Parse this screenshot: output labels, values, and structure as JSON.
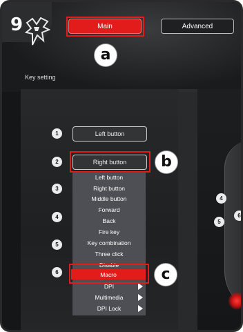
{
  "step_number": "9",
  "tabs": {
    "main_label": "Main",
    "advanced_label": "Advanced"
  },
  "section_label": "Key setting",
  "callouts": {
    "a": "a",
    "b": "b",
    "c": "c"
  },
  "key_rows": [
    {
      "number": "1",
      "label": "Left button"
    },
    {
      "number": "2",
      "label": "Right button"
    },
    {
      "number": "3"
    },
    {
      "number": "4"
    },
    {
      "number": "5"
    },
    {
      "number": "6"
    }
  ],
  "dropdown_items": [
    "Left button",
    "Right button",
    "Middle button",
    "Forward",
    "Back",
    "Fire key",
    "Key combination",
    "Three click",
    "Disable",
    "Macro",
    "DPI",
    "Multimedia",
    "DPI Lock"
  ],
  "dropdown_selected": "Macro",
  "right_peek_numbers": [
    "4",
    "5",
    "6"
  ],
  "colors": {
    "accent": "#e21b1b",
    "background": "#151617",
    "dropdown": "#4e4f55"
  }
}
